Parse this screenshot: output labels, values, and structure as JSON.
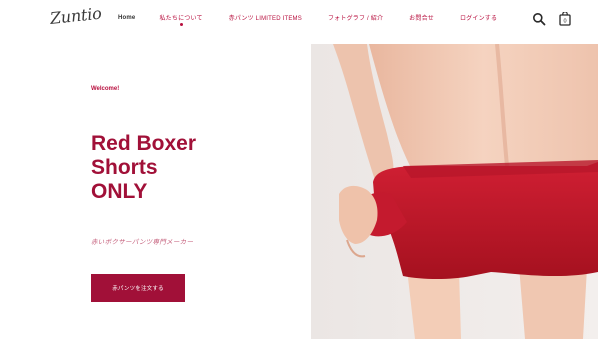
{
  "header": {
    "logo_text": "Zuntio",
    "nav": [
      {
        "label": "Home"
      },
      {
        "label": "私たちについて"
      },
      {
        "label": "赤パンツ LIMITED ITEMS"
      },
      {
        "label": "フォトグラフ / 紹介"
      },
      {
        "label": "お問合せ"
      },
      {
        "label": "ログインする"
      }
    ],
    "icons": [
      "search-icon",
      "cart-icon"
    ]
  },
  "hero": {
    "welcome": "Welcome!",
    "title_lines": [
      "Red Boxer",
      "Shorts",
      "ONLY"
    ],
    "subtitle": "赤いボクサーパンツ専門メーカー",
    "cta_label": "赤パンツを注文する"
  },
  "colors": {
    "brand": "#a11038",
    "accent": "#b8103f",
    "boxer_red": "#c2182e",
    "skin": "#f2cdb8"
  }
}
